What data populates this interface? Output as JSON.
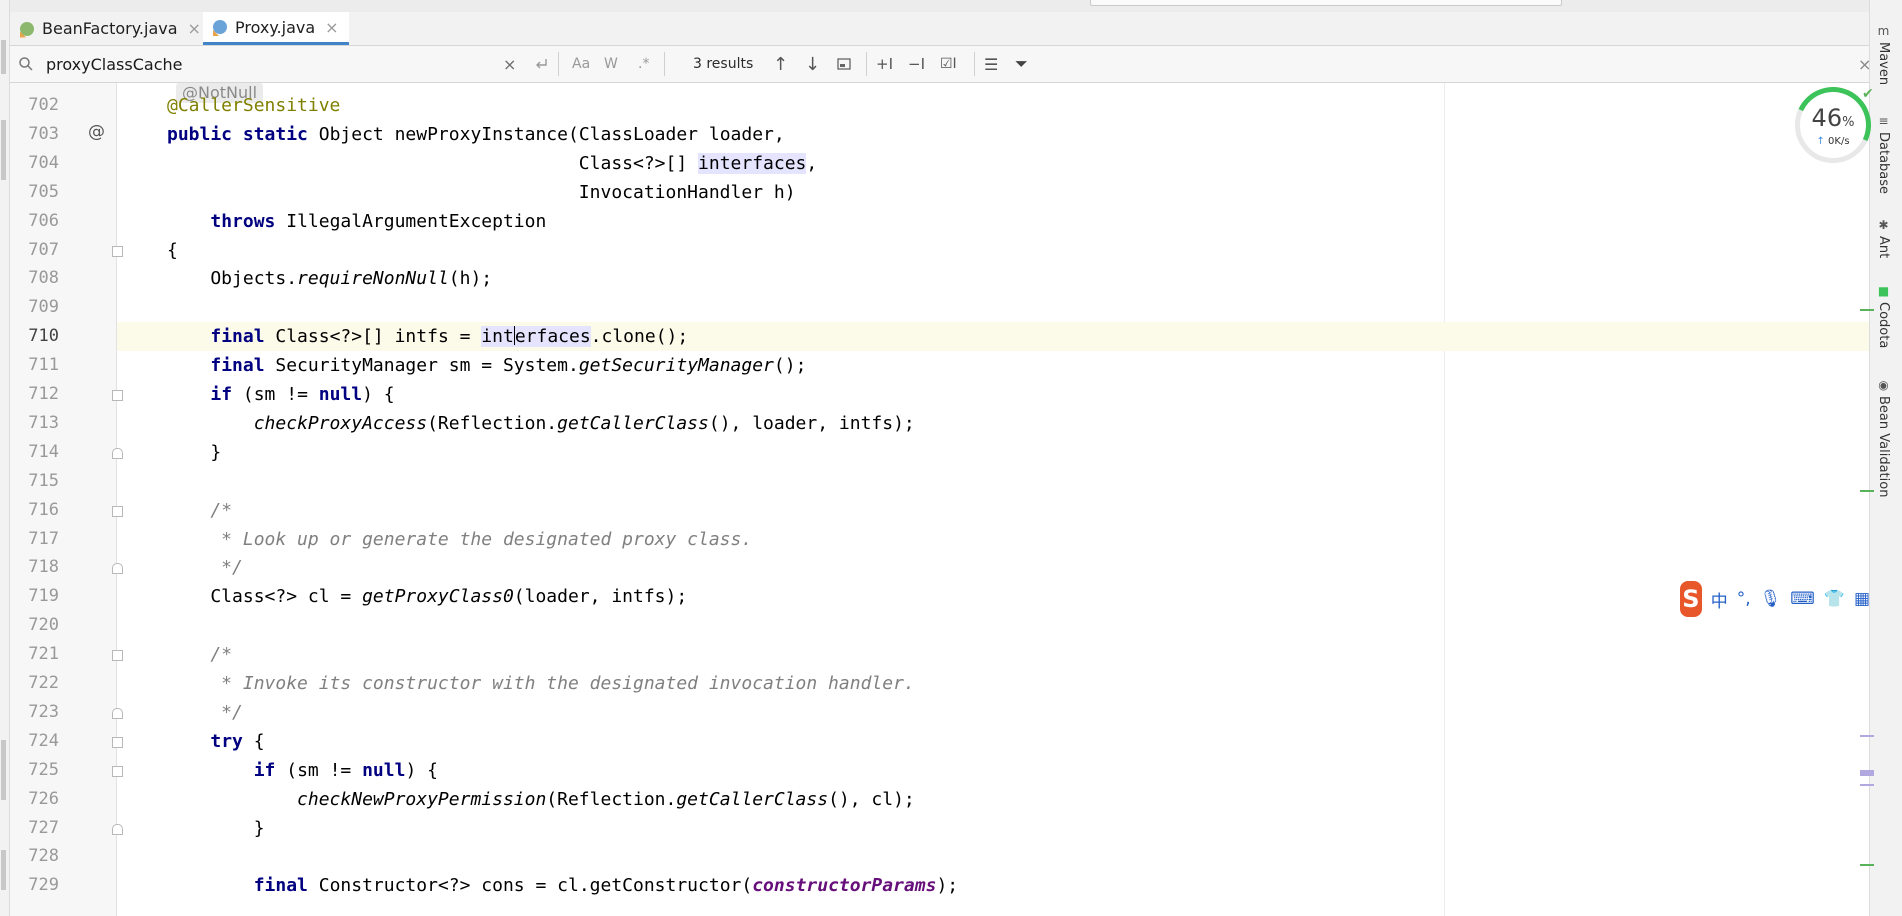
{
  "tabs": [
    {
      "label": "BeanFactory.java",
      "icon": "interface-file-icon",
      "active": false
    },
    {
      "label": "Proxy.java",
      "icon": "class-file-icon",
      "active": true
    }
  ],
  "search": {
    "query": "proxyClassCache",
    "match_case": "Aa",
    "words": "W",
    "regex": ".*",
    "results": "3 results"
  },
  "inlay_hint": "@NotNull",
  "code_lines": [
    {
      "n": "702",
      "html": "<span class='ann'>@CallerSensitive</span>"
    },
    {
      "n": "703",
      "html": "<span class='kw'>public static</span> Object newProxyInstance(ClassLoader loader,"
    },
    {
      "n": "704",
      "html": "                                      Class&lt;?&gt;[] <span class='hl'>interfaces</span>,"
    },
    {
      "n": "705",
      "html": "                                      InvocationHandler h)"
    },
    {
      "n": "706",
      "html": "    <span class='kw'>throws</span> IllegalArgumentException"
    },
    {
      "n": "707",
      "html": "{"
    },
    {
      "n": "708",
      "html": "    Objects.<span class='it'>requireNonNull</span>(h);"
    },
    {
      "n": "709",
      "html": ""
    },
    {
      "n": "710",
      "html": "    <span class='kw'>final</span> Class&lt;?&gt;[] intfs = <span class='hl'>int<span class='caret'></span>erfaces</span>.clone();"
    },
    {
      "n": "711",
      "html": "    <span class='kw'>final</span> SecurityManager sm = System.<span class='it'>getSecurityManager</span>();"
    },
    {
      "n": "712",
      "html": "    <span class='kw'>if</span> (sm != <span class='kw'>null</span>) {"
    },
    {
      "n": "713",
      "html": "        <span class='it'>checkProxyAccess</span>(Reflection.<span class='it'>getCallerClass</span>(), loader, intfs);"
    },
    {
      "n": "714",
      "html": "    }"
    },
    {
      "n": "715",
      "html": ""
    },
    {
      "n": "716",
      "html": "    <span class='cmt'>/*</span>"
    },
    {
      "n": "717",
      "html": "<span class='cmt'>     * Look up or generate the designated proxy class.</span>"
    },
    {
      "n": "718",
      "html": "<span class='cmt'>     */</span>"
    },
    {
      "n": "719",
      "html": "    Class&lt;?&gt; cl = <span class='it'>getProxyClass0</span>(loader, intfs);"
    },
    {
      "n": "720",
      "html": ""
    },
    {
      "n": "721",
      "html": "    <span class='cmt'>/*</span>"
    },
    {
      "n": "722",
      "html": "<span class='cmt'>     * Invoke its constructor with the designated invocation handler.</span>"
    },
    {
      "n": "723",
      "html": "<span class='cmt'>     */</span>"
    },
    {
      "n": "724",
      "html": "    <span class='kw'>try</span> {"
    },
    {
      "n": "725",
      "html": "        <span class='kw'>if</span> (sm != <span class='kw'>null</span>) {"
    },
    {
      "n": "726",
      "html": "            <span class='it'>checkNewProxyPermission</span>(Reflection.<span class='it'>getCallerClass</span>(), cl);"
    },
    {
      "n": "727",
      "html": "        }"
    },
    {
      "n": "728",
      "html": ""
    },
    {
      "n": "729",
      "html": "        <span class='kw'>final</span> Constructor&lt;?&gt; cons = cl.getConstructor(<span class='fld'>constructorParams</span>);"
    }
  ],
  "current_line": "710",
  "tool_windows": [
    "Maven",
    "Database",
    "Ant",
    "Codota",
    "Bean Validation"
  ],
  "speed_widget": {
    "percent": "46",
    "percent_unit": "%",
    "rate": "0K/s"
  },
  "ime": {
    "logo": "S",
    "mode": "中"
  },
  "colors": {
    "keyword": "#000080",
    "annotation": "#808000",
    "comment": "#808080",
    "active_tab_underline": "#4083c9",
    "current_line": "#fcfae8",
    "search_highlight": "#e4e4ff"
  }
}
